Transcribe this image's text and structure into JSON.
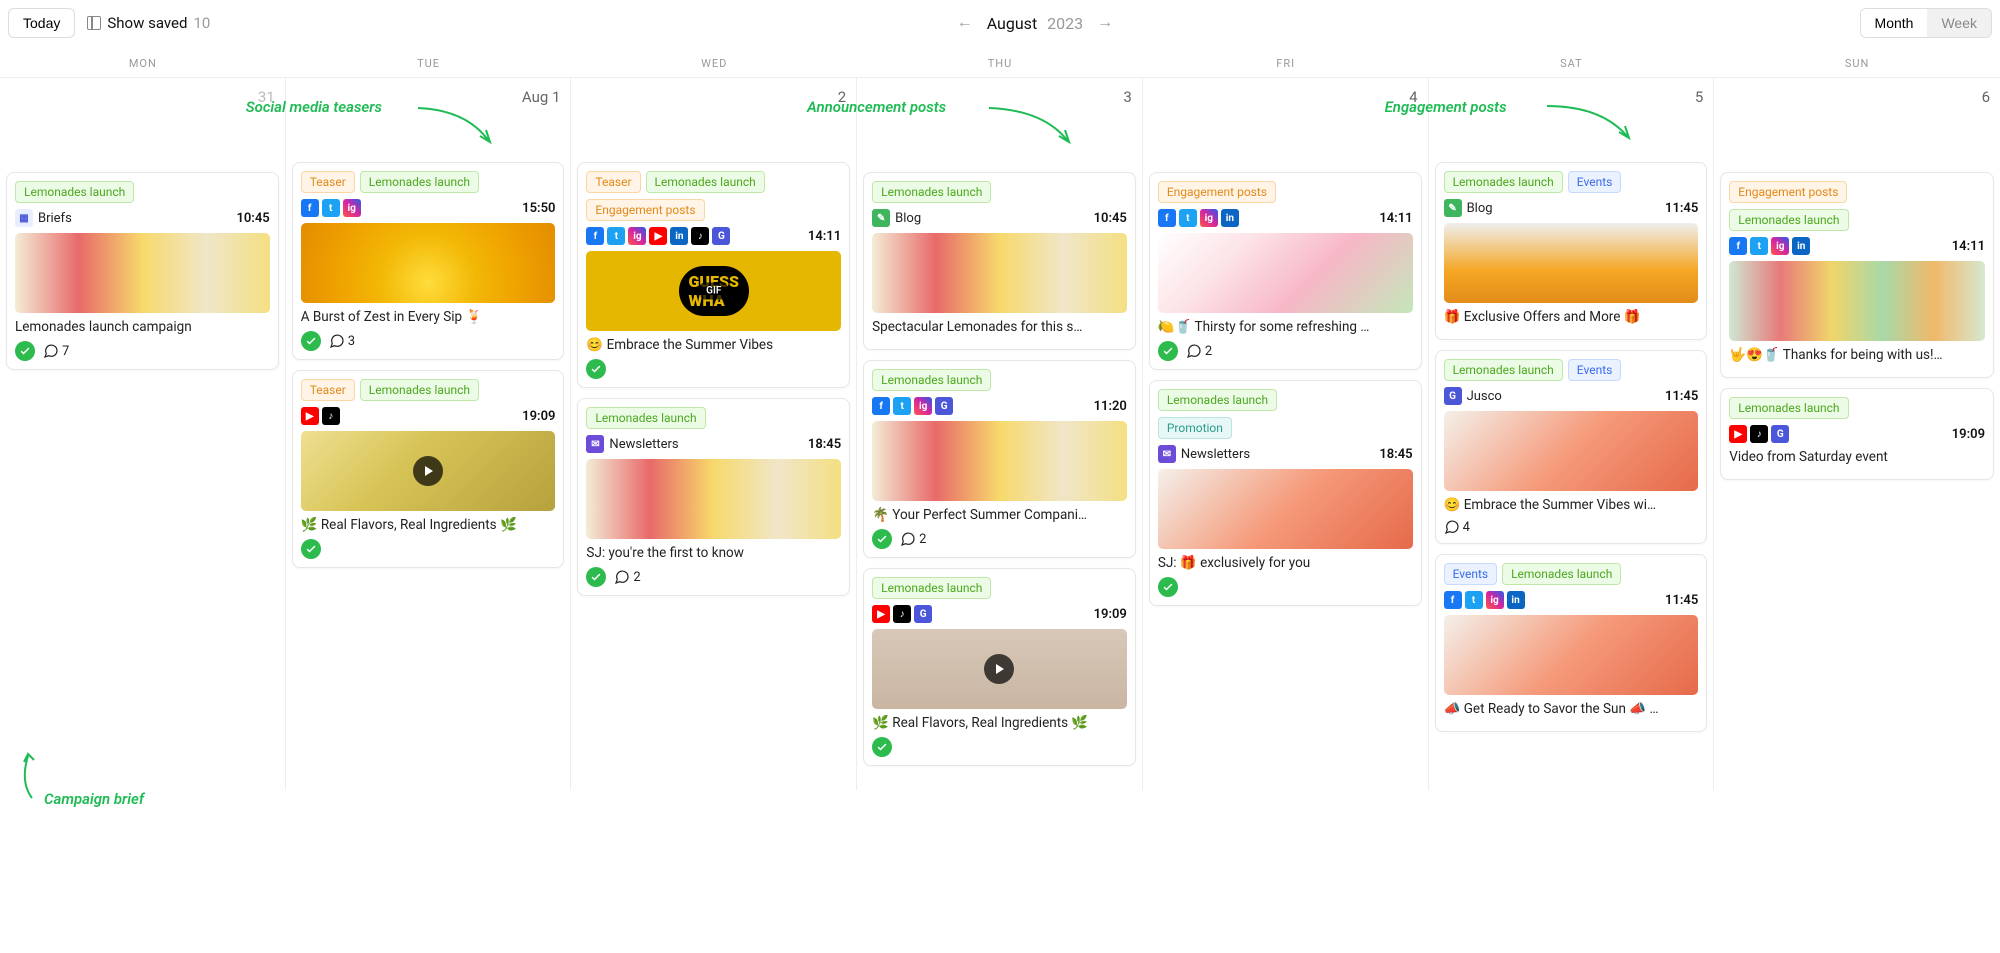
{
  "topbar": {
    "today": "Today",
    "show_saved": "Show saved",
    "saved_count": "10",
    "month": "August",
    "year": "2023",
    "month_btn": "Month",
    "week_btn": "Week"
  },
  "days": [
    "MON",
    "TUE",
    "WED",
    "THU",
    "FRI",
    "SAT",
    "SUN"
  ],
  "dates": [
    "31",
    "Aug 1",
    "2",
    "3",
    "4",
    "5",
    "6"
  ],
  "annotations": {
    "brief": "Campaign brief",
    "teasers": "Social media teasers",
    "announce": "Announcement posts",
    "engage": "Engagement posts"
  },
  "tags": {
    "lemon": "Lemonades launch",
    "teaser": "Teaser",
    "engage": "Engagement posts",
    "events": "Events",
    "promo": "Promotion"
  },
  "labels": {
    "briefs": "Briefs",
    "blog": "Blog",
    "news": "Newsletters",
    "jusco": "Jusco"
  },
  "icons": {
    "fb": "f",
    "tw": "t",
    "ig": "ig",
    "yt": "▶",
    "li": "in",
    "tt": "♪",
    "gb": "G",
    "nl": "✉",
    "bl": "✎",
    "doc": "▦"
  },
  "cards": {
    "mon1": {
      "time": "10:45",
      "title": "Lemonades launch campaign",
      "comments": "7"
    },
    "tue1": {
      "time": "15:50",
      "title": "A Burst of Zest in Every Sip 🍹",
      "comments": "3"
    },
    "tue2": {
      "time": "19:09",
      "title": "🌿 Real Flavors, Real Ingredients 🌿"
    },
    "wed1": {
      "time": "14:11",
      "title": "😊 Embrace the Summer Vibes"
    },
    "wed2": {
      "time": "18:45",
      "title": "SJ: you're the first to know",
      "comments": "2"
    },
    "thu1": {
      "time": "10:45",
      "title": "Spectacular Lemonades for this s…"
    },
    "thu2": {
      "time": "11:20",
      "title": "🌴 Your Perfect Summer Compani…",
      "comments": "2"
    },
    "thu3": {
      "time": "19:09",
      "title": "🌿 Real Flavors, Real Ingredients 🌿"
    },
    "fri1": {
      "time": "14:11",
      "title": "🍋🥤 Thirsty for some refreshing …",
      "comments": "2"
    },
    "fri2": {
      "time": "18:45",
      "title": "SJ: 🎁 exclusively for you"
    },
    "sat1": {
      "time": "11:45",
      "title": "🎁 Exclusive Offers and More 🎁"
    },
    "sat2": {
      "time": "11:45",
      "title": "😊 Embrace the Summer Vibes wi…",
      "comments": "4"
    },
    "sat3": {
      "time": "11:45",
      "title": "📣 Get Ready to Savor the Sun 📣 …"
    },
    "sun1": {
      "time": "14:11",
      "title": "🤟😍🥤 Thanks for being with us!…"
    },
    "sun2": {
      "time": "19:09",
      "title": "Video from Saturday event"
    }
  }
}
